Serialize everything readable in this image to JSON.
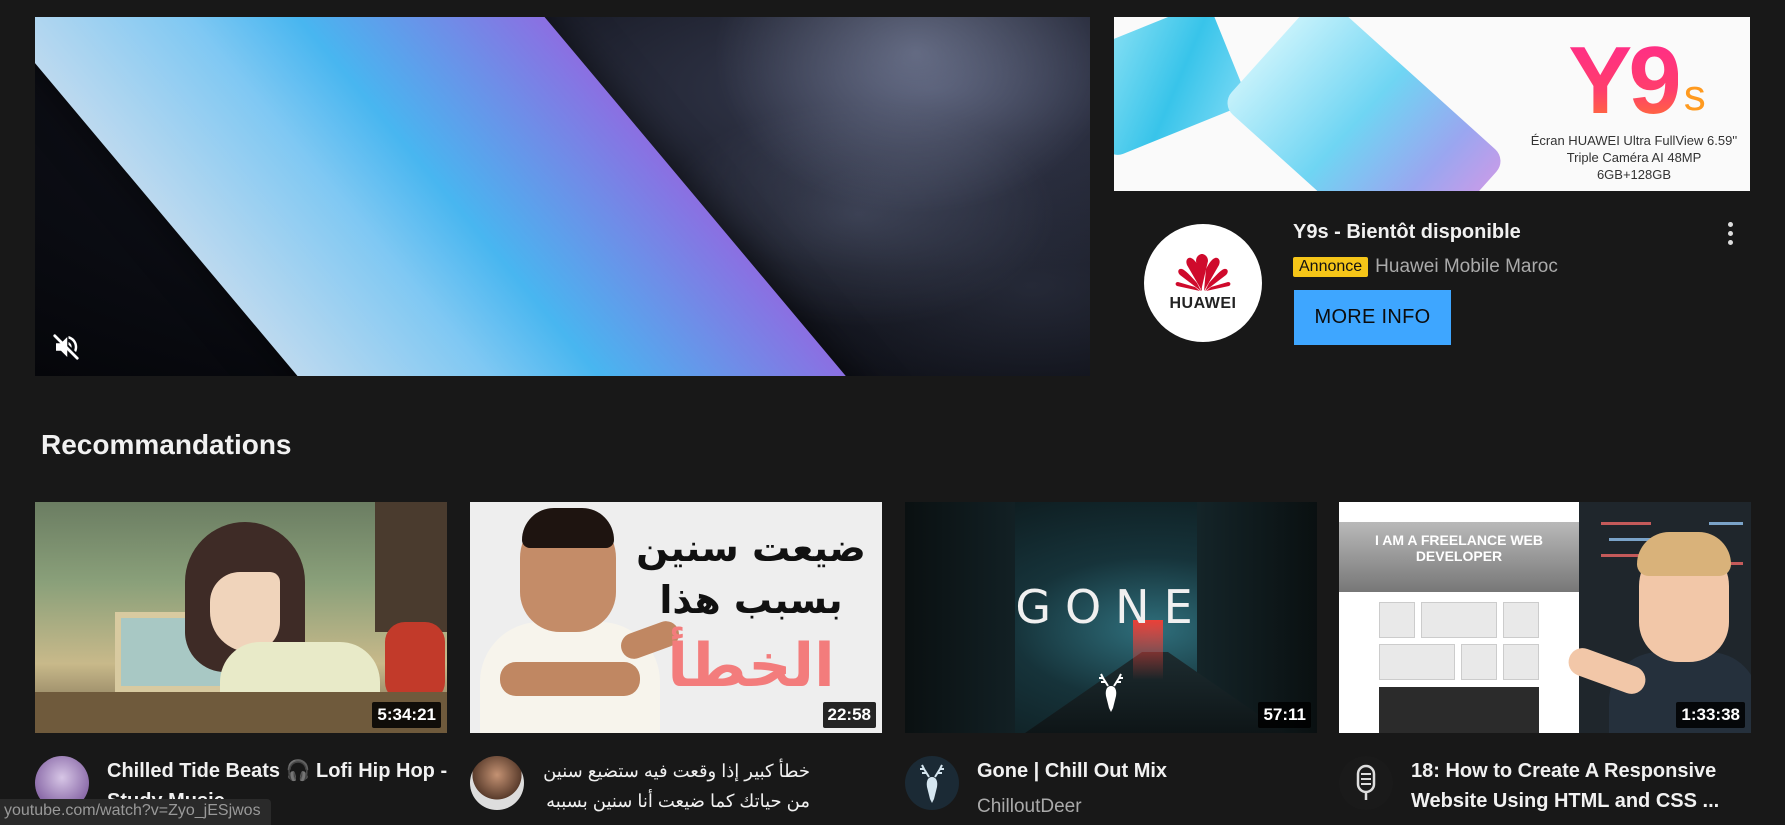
{
  "ad": {
    "banner": {
      "brand_y9": "Y9",
      "brand_s": "s",
      "spec_line1": "Écran HUAWEI Ultra FullView 6.59''",
      "spec_line2": "Triple Caméra AI 48MP",
      "spec_line3": "6GB+128GB"
    },
    "logo_text": "HUAWEI",
    "title": "Y9s - Bientôt disponible",
    "badge": "Annonce",
    "advertiser": "Huawei Mobile Maroc",
    "cta_label": "MORE INFO",
    "colors": {
      "cta": "#3ea6ff",
      "badge": "#f5c518",
      "logo_red": "#cf0a2c"
    }
  },
  "section": {
    "title": "Recommandations"
  },
  "videos": [
    {
      "title": "Chilled Tide Beats 🎧 Lofi Hip Hop - Study Music",
      "channel": "",
      "duration": "5:34:21"
    },
    {
      "title": "خطأ كبير إذا وقعت فيه ستضيع سنين من حياتك كما ضيعت أنا سنين بسببه",
      "channel": "",
      "duration": "22:58",
      "thumb_line1": "ضيعت سنين",
      "thumb_line2": "بسبب هذا",
      "thumb_line3": "الخطأ"
    },
    {
      "title": "Gone | Chill Out Mix",
      "channel": "ChilloutDeer",
      "duration": "57:11",
      "thumb_title": "GONE"
    },
    {
      "title": "18: How to Create A Responsive Website Using HTML and CSS ...",
      "channel": "",
      "duration": "1:33:38",
      "thumb_headline": "I AM A FREELANCE WEB DEVELOPER"
    }
  ],
  "status_bar": {
    "url": "youtube.com/watch?v=Zyo_jESjwos"
  }
}
